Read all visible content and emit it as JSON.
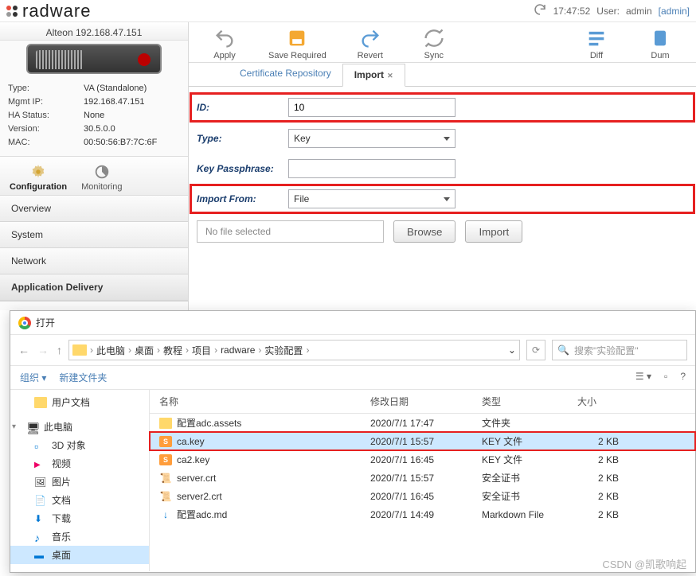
{
  "brand": "radware",
  "header": {
    "time": "17:47:52",
    "user_label": "User:",
    "user_name": "admin",
    "user_role": "[admin]"
  },
  "device": {
    "title": "Alteon 192.168.47.151",
    "info": [
      {
        "label": "Type:",
        "value": "VA (Standalone)"
      },
      {
        "label": "Mgmt IP:",
        "value": "192.168.47.151"
      },
      {
        "label": "HA Status:",
        "value": "None"
      },
      {
        "label": "Version:",
        "value": "30.5.0.0"
      },
      {
        "label": "MAC:",
        "value": "00:50:56:B7:7C:6F"
      }
    ]
  },
  "modes": {
    "config": "Configuration",
    "monitor": "Monitoring"
  },
  "nav": [
    "Overview",
    "System",
    "Network",
    "Application Delivery"
  ],
  "toolbar": [
    "Apply",
    "Save Required",
    "Revert",
    "Sync",
    "Diff",
    "Dum"
  ],
  "subtabs": {
    "repo": "Certificate Repository",
    "import": "Import"
  },
  "form": {
    "id_label": "ID:",
    "id_value": "10",
    "type_label": "Type:",
    "type_value": "Key",
    "pass_label": "Key Passphrase:",
    "pass_value": "",
    "from_label": "Import From:",
    "from_value": "File",
    "no_file": "No file selected",
    "browse": "Browse",
    "import": "Import"
  },
  "dialog": {
    "title": "打开",
    "breadcrumb": [
      "此电脑",
      "桌面",
      "教程",
      "项目",
      "radware",
      "实验配置"
    ],
    "search_placeholder": "搜索\"实验配置\"",
    "tools": {
      "org": "组织",
      "newf": "新建文件夹"
    },
    "tree": [
      {
        "label": "用户文档",
        "icon": "folder"
      },
      {
        "label": "此电脑",
        "icon": "pc",
        "caret": "▾"
      },
      {
        "label": "3D 对象",
        "icon": "3d"
      },
      {
        "label": "视频",
        "icon": "video"
      },
      {
        "label": "图片",
        "icon": "pic"
      },
      {
        "label": "文档",
        "icon": "doc"
      },
      {
        "label": "下载",
        "icon": "dl"
      },
      {
        "label": "音乐",
        "icon": "music"
      },
      {
        "label": "桌面",
        "icon": "desk",
        "sel": true
      }
    ],
    "cols": {
      "name": "名称",
      "date": "修改日期",
      "type": "类型",
      "size": "大小"
    },
    "files": [
      {
        "name": "配置adc.assets",
        "date": "2020/7/1 17:47",
        "type": "文件夹",
        "size": "",
        "icon": "folder"
      },
      {
        "name": "ca.key",
        "date": "2020/7/1 15:57",
        "type": "KEY 文件",
        "size": "2 KB",
        "icon": "key",
        "sel": true,
        "hl": true
      },
      {
        "name": "ca2.key",
        "date": "2020/7/1 16:45",
        "type": "KEY 文件",
        "size": "2 KB",
        "icon": "key"
      },
      {
        "name": "server.crt",
        "date": "2020/7/1 15:57",
        "type": "安全证书",
        "size": "2 KB",
        "icon": "cert"
      },
      {
        "name": "server2.crt",
        "date": "2020/7/1 16:45",
        "type": "安全证书",
        "size": "2 KB",
        "icon": "cert"
      },
      {
        "name": "配置adc.md",
        "date": "2020/7/1 14:49",
        "type": "Markdown File",
        "size": "2 KB",
        "icon": "md"
      }
    ]
  },
  "watermark": "CSDN @凯歌响起"
}
